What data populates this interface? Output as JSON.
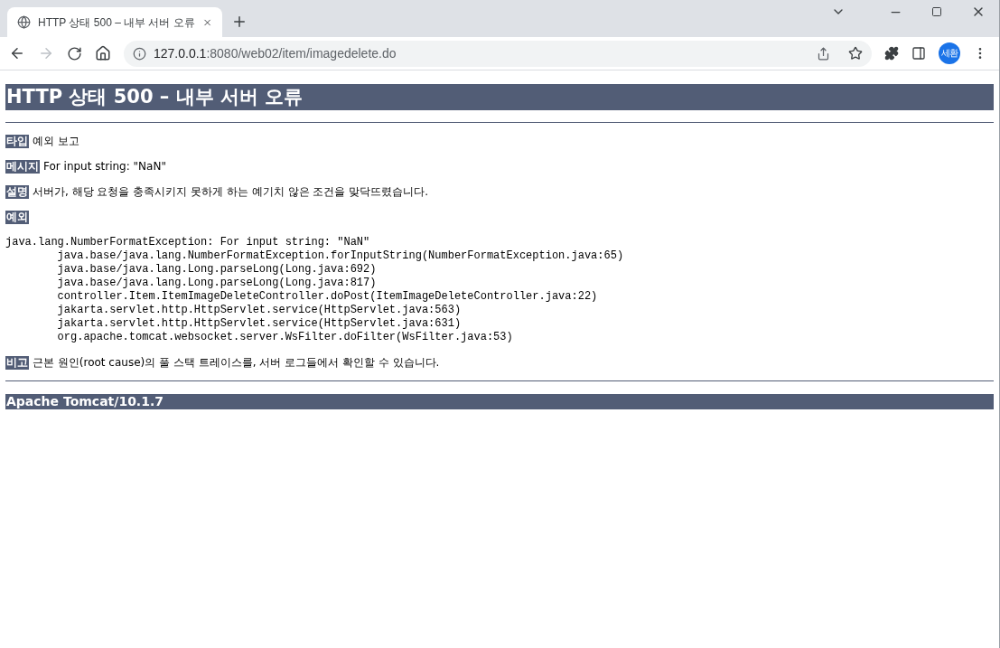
{
  "tabs": [
    {
      "title": "HTTP 상태 500 – 내부 서버 오류",
      "selected": true
    }
  ],
  "address_bar": {
    "host": "127.0.0.1",
    "path": ":8080/web02/item/imagedelete.do"
  },
  "profile": {
    "initials": "세환"
  },
  "page": {
    "heading": "HTTP 상태 500 – 내부 서버 오류",
    "sections": [
      {
        "label": "타입",
        "text": "예외 보고"
      },
      {
        "label": "메시지",
        "text": "For input string: \"NaN\""
      },
      {
        "label": "설명",
        "text": "서버가, 해당 요청을 충족시키지 못하게 하는 예기치 않은 조건을 맞닥뜨렸습니다."
      },
      {
        "label": "예외"
      }
    ],
    "trace": {
      "exception": "java.lang.NumberFormatException: For input string: \"NaN\"",
      "frames": [
        "java.base/java.lang.NumberFormatException.forInputString(NumberFormatException.java:65)",
        "java.base/java.lang.Long.parseLong(Long.java:692)",
        "java.base/java.lang.Long.parseLong(Long.java:817)",
        "controller.Item.ItemImageDeleteController.doPost(ItemImageDeleteController.java:22)",
        "jakarta.servlet.http.HttpServlet.service(HttpServlet.java:563)",
        "jakarta.servlet.http.HttpServlet.service(HttpServlet.java:631)",
        "org.apache.tomcat.websocket.server.WsFilter.doFilter(WsFilter.java:53)"
      ]
    },
    "note": {
      "label": "비고",
      "text": "근본 원인(root cause)의 풀 스택 트레이스를, 서버 로그들에서 확인할 수 있습니다."
    },
    "footer": "Apache Tomcat/10.1.7"
  }
}
